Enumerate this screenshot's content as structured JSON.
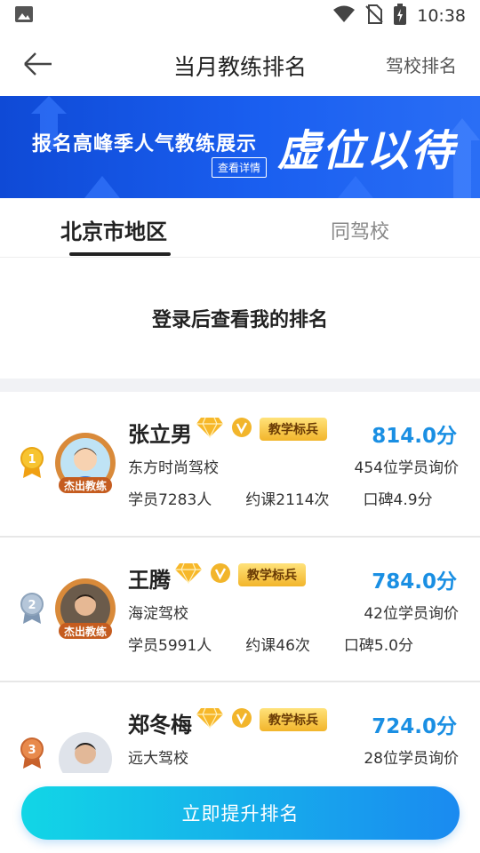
{
  "status_bar": {
    "time": "10:38",
    "icons": [
      "image-icon",
      "wifi-icon",
      "no-sim-icon",
      "battery-charging-icon"
    ]
  },
  "header": {
    "title": "当月教练排名",
    "action_label": "驾校排名",
    "back_icon": "back-arrow-icon"
  },
  "banner": {
    "headline": "报名高峰季人气教练展示",
    "detail_button": "查看详情",
    "calligraphy": "虚位以待",
    "background_color": "#1a5ff0"
  },
  "tabs": [
    {
      "label": "北京市地区",
      "active": true
    },
    {
      "label": "同驾校",
      "active": false
    }
  ],
  "login_prompt": "登录后查看我的排名",
  "ranking": [
    {
      "rank": "1",
      "medal": "gold-medal-icon",
      "avatar_badge": "杰出教练",
      "name": "张立男",
      "badge_label": "教学标兵",
      "score": "814.0分",
      "school": "东方时尚驾校",
      "inquiries": "454位学员询价",
      "students": "学员7283人",
      "lessons": "约课2114次",
      "reputation": "口碑4.9分"
    },
    {
      "rank": "2",
      "medal": "silver-medal-icon",
      "avatar_badge": "杰出教练",
      "name": "王腾",
      "badge_label": "教学标兵",
      "score": "784.0分",
      "school": "海淀驾校",
      "inquiries": "42位学员询价",
      "students": "学员5991人",
      "lessons": "约课46次",
      "reputation": "口碑5.0分"
    },
    {
      "rank": "3",
      "medal": "bronze-medal-icon",
      "avatar_badge": "",
      "name": "郑冬梅",
      "badge_label": "教学标兵",
      "score": "724.0分",
      "school": "远大驾校",
      "inquiries": "28位学员询价",
      "students": "",
      "lessons": "",
      "reputation": ""
    }
  ],
  "cta": {
    "label": "立即提升排名"
  },
  "colors": {
    "accent_blue": "#1a8fe3",
    "cta_start": "#12d6e6",
    "cta_end": "#1a8af0",
    "badge_gold": "#f2b52b"
  }
}
